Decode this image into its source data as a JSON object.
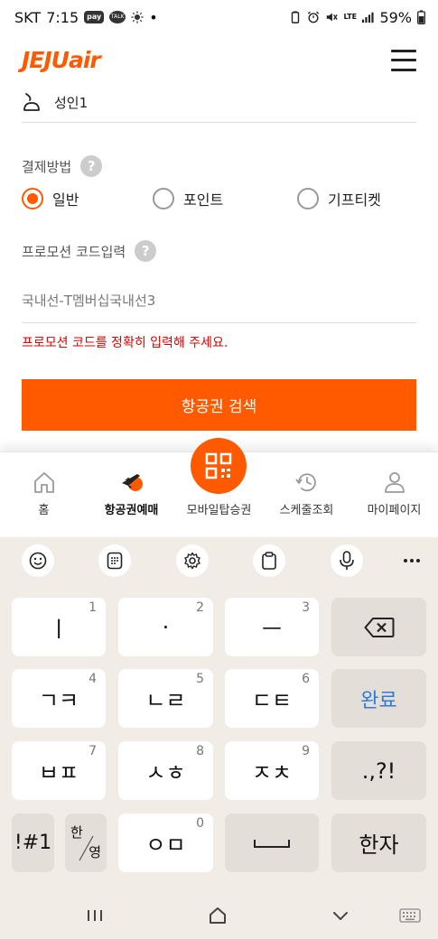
{
  "status_bar": {
    "carrier": "SKT",
    "time": "7:15",
    "pay_badge": "pay",
    "talk_badge": "TALK",
    "dot": "•",
    "lte": "LTE",
    "battery": "59%"
  },
  "header": {
    "logo_text": "JEJUair",
    "menu_icon": "hamburger-icon"
  },
  "form": {
    "passenger_value": "성인1",
    "payment_label": "결제방법",
    "payment_options": [
      "일반",
      "포인트",
      "기프티켓"
    ],
    "payment_selected": "일반",
    "promo_label": "프로모션 코드입력",
    "promo_value": "국내선-T멤버십국내선3",
    "error_text": "프로모션 코드를 정확히 입력해 주세요.",
    "help_glyph": "?",
    "search_button": "항공권 검색"
  },
  "bottom_nav": {
    "items": [
      "홈",
      "항공권예매",
      "모바일탑승권",
      "스케줄조회",
      "마이페이지"
    ],
    "active": "항공권예매"
  },
  "keyboard": {
    "rows": [
      [
        {
          "main": "ㅣ",
          "num": "1"
        },
        {
          "main": "·",
          "num": "2"
        },
        {
          "main": "ㅡ",
          "num": "3"
        }
      ],
      [
        {
          "main": "ㄱㅋ",
          "num": "4"
        },
        {
          "main": "ㄴㄹ",
          "num": "5"
        },
        {
          "main": "ㄷㅌ",
          "num": "6"
        }
      ],
      [
        {
          "main": "ㅂㅍ",
          "num": "7"
        },
        {
          "main": "ㅅㅎ",
          "num": "8"
        },
        {
          "main": "ㅈㅊ",
          "num": "9"
        }
      ]
    ],
    "done": "완료",
    "punct": ".,?!",
    "symbols": "!#1",
    "lang_top": "한",
    "lang_bottom": "영",
    "zero_main": "ㅇㅁ",
    "zero_num": "0",
    "hanja": "한자"
  },
  "colors": {
    "brand": "#ff5a00",
    "error": "#e00000",
    "done_key": "#2f7bd6"
  }
}
